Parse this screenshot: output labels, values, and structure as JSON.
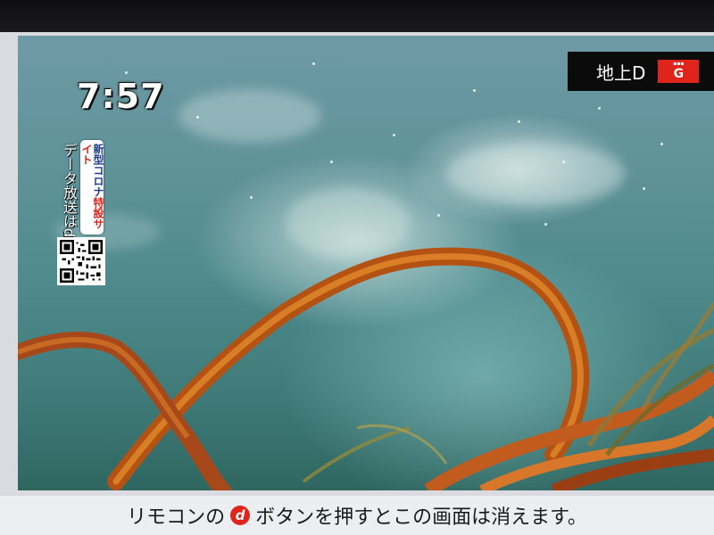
{
  "screen": {
    "clock": "7:57",
    "channel": {
      "label": "地上D",
      "mark": "G",
      "mark_color": "#e0241b"
    },
    "data_broadcast": {
      "vertical_text": "データ放送はd",
      "covid_line1": "新型コロナ",
      "covid_line2": "特設サイト"
    },
    "bottom_bar": {
      "text_before": "リモコンの",
      "icon": "d-button-icon",
      "icon_glyph": "d",
      "text_after": "ボタンを押すとこの画面は消えます。"
    }
  },
  "colors": {
    "water": "#4e8a8c",
    "kelp": "#c0641a",
    "accent_red": "#e0241b"
  }
}
